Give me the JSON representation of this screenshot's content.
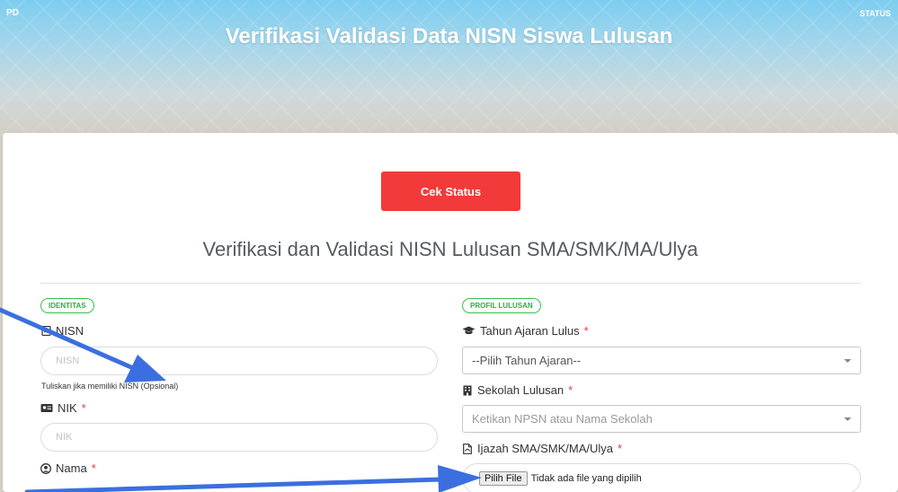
{
  "header": {
    "brand": "PD",
    "nav_status": "STATUS",
    "title": "Verifikasi Validasi Data NISN Siswa Lulusan"
  },
  "card": {
    "cek_status_label": "Cek Status",
    "form_title": "Verifikasi dan Validasi NISN Lulusan SMA/SMK/MA/Ulya"
  },
  "identitas": {
    "badge": "IDENTITAS",
    "nisn_label": "NISN",
    "nisn_placeholder": "NISN",
    "nisn_help": "Tuliskan jika memiliki NISN (Opsional)",
    "nik_label": "NIK",
    "nik_placeholder": "NIK",
    "nama_label": "Nama",
    "required_mark": "*"
  },
  "profil": {
    "badge": "PROFIL LULUSAN",
    "tahun_label": "Tahun Ajaran Lulus",
    "tahun_value": "--Pilih Tahun Ajaran--",
    "sekolah_label": "Sekolah Lulusan",
    "sekolah_placeholder": "Ketikan NPSN atau Nama Sekolah",
    "ijazah_label": "Ijazah SMA/SMK/MA/Ulya",
    "file_button": "Pilih File",
    "file_status": "Tidak ada file yang dipilih",
    "required_mark": "*"
  },
  "icons": {
    "nisn": "id-card-icon",
    "nik": "id-badge-icon",
    "nama": "user-circle-icon",
    "tahun": "graduation-cap-icon",
    "sekolah": "building-icon",
    "ijazah": "file-pdf-icon"
  },
  "colors": {
    "accent_red": "#f33a3a",
    "badge_green": "#37c14a",
    "arrow_blue": "#3b6fe0"
  }
}
